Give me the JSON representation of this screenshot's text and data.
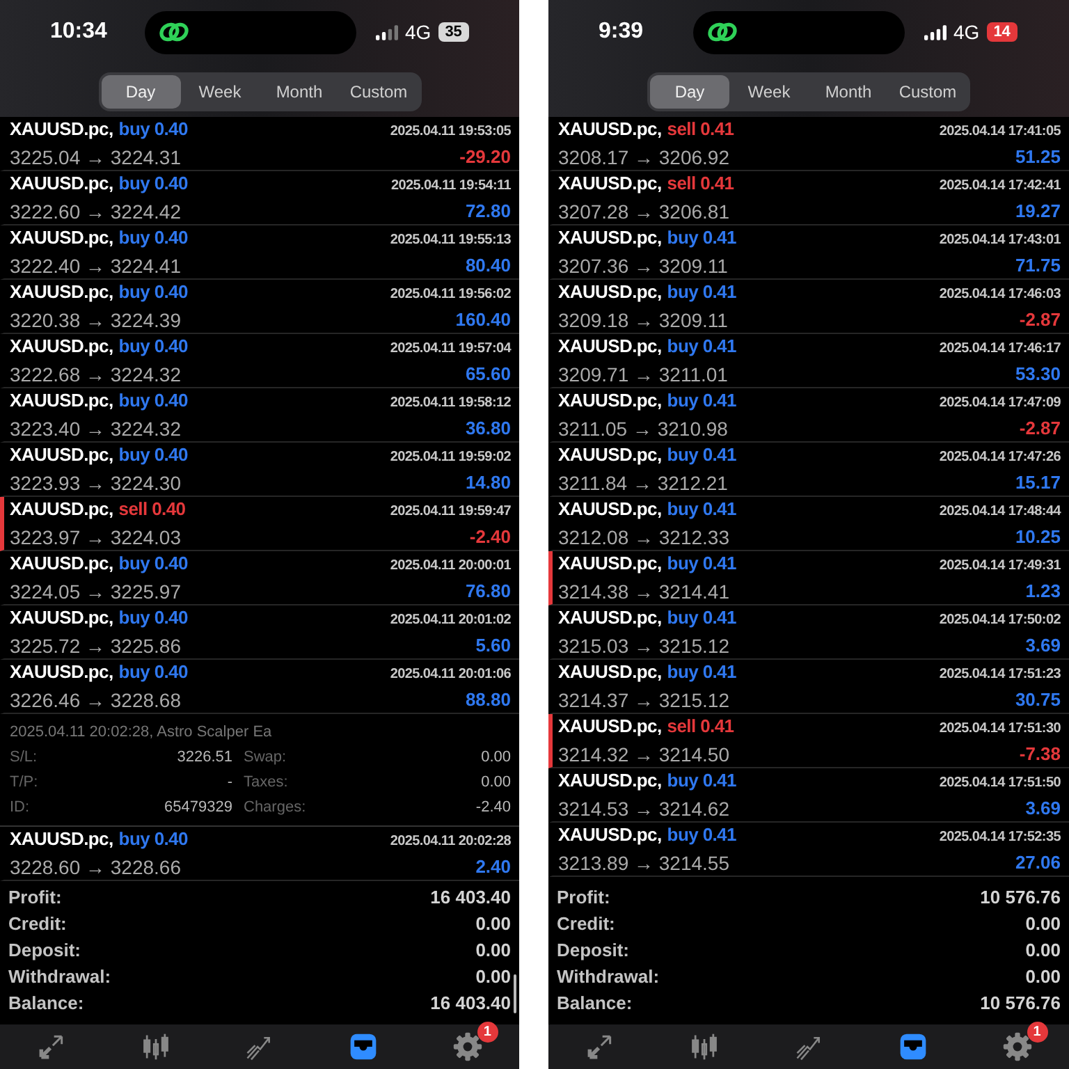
{
  "phones": [
    {
      "status": {
        "time": "10:34",
        "network": "4G",
        "battery": "35",
        "battery_low": false
      },
      "tabs": [
        {
          "label": "Day",
          "selected": true
        },
        {
          "label": "Week",
          "selected": false
        },
        {
          "label": "Month",
          "selected": false
        },
        {
          "label": "Custom",
          "selected": false
        }
      ],
      "items": [
        {
          "kind": "deal",
          "symbol": "XAUUSD.pc,",
          "side": "buy",
          "volume": "0.40",
          "time": "2025.04.11 19:53:05",
          "prices": "3225.04 → 3224.31",
          "profit": "-29.20",
          "negative": true,
          "marked": false
        },
        {
          "kind": "deal",
          "symbol": "XAUUSD.pc,",
          "side": "buy",
          "volume": "0.40",
          "time": "2025.04.11 19:54:11",
          "prices": "3222.60 → 3224.42",
          "profit": "72.80",
          "negative": false,
          "marked": false
        },
        {
          "kind": "deal",
          "symbol": "XAUUSD.pc,",
          "side": "buy",
          "volume": "0.40",
          "time": "2025.04.11 19:55:13",
          "prices": "3222.40 → 3224.41",
          "profit": "80.40",
          "negative": false,
          "marked": false
        },
        {
          "kind": "deal",
          "symbol": "XAUUSD.pc,",
          "side": "buy",
          "volume": "0.40",
          "time": "2025.04.11 19:56:02",
          "prices": "3220.38 → 3224.39",
          "profit": "160.40",
          "negative": false,
          "marked": false
        },
        {
          "kind": "deal",
          "symbol": "XAUUSD.pc,",
          "side": "buy",
          "volume": "0.40",
          "time": "2025.04.11 19:57:04",
          "prices": "3222.68 → 3224.32",
          "profit": "65.60",
          "negative": false,
          "marked": false
        },
        {
          "kind": "deal",
          "symbol": "XAUUSD.pc,",
          "side": "buy",
          "volume": "0.40",
          "time": "2025.04.11 19:58:12",
          "prices": "3223.40 → 3224.32",
          "profit": "36.80",
          "negative": false,
          "marked": false
        },
        {
          "kind": "deal",
          "symbol": "XAUUSD.pc,",
          "side": "buy",
          "volume": "0.40",
          "time": "2025.04.11 19:59:02",
          "prices": "3223.93 → 3224.30",
          "profit": "14.80",
          "negative": false,
          "marked": false
        },
        {
          "kind": "deal",
          "symbol": "XAUUSD.pc,",
          "side": "sell",
          "volume": "0.40",
          "time": "2025.04.11 19:59:47",
          "prices": "3223.97 → 3224.03",
          "profit": "-2.40",
          "negative": true,
          "marked": true
        },
        {
          "kind": "deal",
          "symbol": "XAUUSD.pc,",
          "side": "buy",
          "volume": "0.40",
          "time": "2025.04.11 20:00:01",
          "prices": "3224.05 → 3225.97",
          "profit": "76.80",
          "negative": false,
          "marked": false
        },
        {
          "kind": "deal",
          "symbol": "XAUUSD.pc,",
          "side": "buy",
          "volume": "0.40",
          "time": "2025.04.11 20:01:02",
          "prices": "3225.72 → 3225.86",
          "profit": "5.60",
          "negative": false,
          "marked": false
        },
        {
          "kind": "deal",
          "symbol": "XAUUSD.pc,",
          "side": "buy",
          "volume": "0.40",
          "time": "2025.04.11 20:01:06",
          "prices": "3226.46 → 3228.68",
          "profit": "88.80",
          "negative": false,
          "marked": false
        },
        {
          "kind": "detail",
          "comment": "2025.04.11 20:02:28, Astro Scalper Ea",
          "rows": [
            {
              "fields": [
                {
                  "label": "S/L:",
                  "value": "3226.51"
                },
                {
                  "label": "Swap:",
                  "value": "0.00"
                }
              ]
            },
            {
              "fields": [
                {
                  "label": "T/P:",
                  "value": "-"
                },
                {
                  "label": "Taxes:",
                  "value": "0.00"
                }
              ]
            },
            {
              "fields": [
                {
                  "label": "ID:",
                  "value": "65479329"
                },
                {
                  "label": "Charges:",
                  "value": "-2.40"
                }
              ]
            }
          ]
        },
        {
          "kind": "deal",
          "symbol": "XAUUSD.pc,",
          "side": "buy",
          "volume": "0.40",
          "time": "2025.04.11 20:02:28",
          "prices": "3228.60 → 3228.66",
          "profit": "2.40",
          "negative": false,
          "marked": false
        }
      ],
      "summary": [
        {
          "label": "Profit:",
          "value": "16 403.40"
        },
        {
          "label": "Credit:",
          "value": "0.00"
        },
        {
          "label": "Deposit:",
          "value": "0.00"
        },
        {
          "label": "Withdrawal:",
          "value": "0.00"
        },
        {
          "label": "Balance:",
          "value": "16 403.40"
        }
      ],
      "nav": [
        {
          "kind": "trade",
          "selected": false
        },
        {
          "kind": "chart",
          "selected": false
        },
        {
          "kind": "analytics",
          "selected": false
        },
        {
          "kind": "history",
          "selected": true
        },
        {
          "kind": "settings",
          "selected": false,
          "badge": "1"
        }
      ]
    },
    {
      "status": {
        "time": "9:39",
        "network": "4G",
        "battery": "14",
        "battery_low": true
      },
      "tabs": [
        {
          "label": "Day",
          "selected": true
        },
        {
          "label": "Week",
          "selected": false
        },
        {
          "label": "Month",
          "selected": false
        },
        {
          "label": "Custom",
          "selected": false
        }
      ],
      "items": [
        {
          "kind": "deal",
          "symbol": "XAUUSD.pc,",
          "side": "sell",
          "volume": "0.41",
          "time": "2025.04.14 17:41:05",
          "prices": "3208.17 → 3206.92",
          "profit": "51.25",
          "negative": false,
          "marked": false
        },
        {
          "kind": "deal",
          "symbol": "XAUUSD.pc,",
          "side": "sell",
          "volume": "0.41",
          "time": "2025.04.14 17:42:41",
          "prices": "3207.28 → 3206.81",
          "profit": "19.27",
          "negative": false,
          "marked": false
        },
        {
          "kind": "deal",
          "symbol": "XAUUSD.pc,",
          "side": "buy",
          "volume": "0.41",
          "time": "2025.04.14 17:43:01",
          "prices": "3207.36 → 3209.11",
          "profit": "71.75",
          "negative": false,
          "marked": false
        },
        {
          "kind": "deal",
          "symbol": "XAUUSD.pc,",
          "side": "buy",
          "volume": "0.41",
          "time": "2025.04.14 17:46:03",
          "prices": "3209.18 → 3209.11",
          "profit": "-2.87",
          "negative": true,
          "marked": false
        },
        {
          "kind": "deal",
          "symbol": "XAUUSD.pc,",
          "side": "buy",
          "volume": "0.41",
          "time": "2025.04.14 17:46:17",
          "prices": "3209.71 → 3211.01",
          "profit": "53.30",
          "negative": false,
          "marked": false
        },
        {
          "kind": "deal",
          "symbol": "XAUUSD.pc,",
          "side": "buy",
          "volume": "0.41",
          "time": "2025.04.14 17:47:09",
          "prices": "3211.05 → 3210.98",
          "profit": "-2.87",
          "negative": true,
          "marked": false
        },
        {
          "kind": "deal",
          "symbol": "XAUUSD.pc,",
          "side": "buy",
          "volume": "0.41",
          "time": "2025.04.14 17:47:26",
          "prices": "3211.84 → 3212.21",
          "profit": "15.17",
          "negative": false,
          "marked": false
        },
        {
          "kind": "deal",
          "symbol": "XAUUSD.pc,",
          "side": "buy",
          "volume": "0.41",
          "time": "2025.04.14 17:48:44",
          "prices": "3212.08 → 3212.33",
          "profit": "10.25",
          "negative": false,
          "marked": false
        },
        {
          "kind": "deal",
          "symbol": "XAUUSD.pc,",
          "side": "buy",
          "volume": "0.41",
          "time": "2025.04.14 17:49:31",
          "prices": "3214.38 → 3214.41",
          "profit": "1.23",
          "negative": false,
          "marked": true
        },
        {
          "kind": "deal",
          "symbol": "XAUUSD.pc,",
          "side": "buy",
          "volume": "0.41",
          "time": "2025.04.14 17:50:02",
          "prices": "3215.03 → 3215.12",
          "profit": "3.69",
          "negative": false,
          "marked": false
        },
        {
          "kind": "deal",
          "symbol": "XAUUSD.pc,",
          "side": "buy",
          "volume": "0.41",
          "time": "2025.04.14 17:51:23",
          "prices": "3214.37 → 3215.12",
          "profit": "30.75",
          "negative": false,
          "marked": false
        },
        {
          "kind": "deal",
          "symbol": "XAUUSD.pc,",
          "side": "sell",
          "volume": "0.41",
          "time": "2025.04.14 17:51:30",
          "prices": "3214.32 → 3214.50",
          "profit": "-7.38",
          "negative": true,
          "marked": true
        },
        {
          "kind": "deal",
          "symbol": "XAUUSD.pc,",
          "side": "buy",
          "volume": "0.41",
          "time": "2025.04.14 17:51:50",
          "prices": "3214.53 → 3214.62",
          "profit": "3.69",
          "negative": false,
          "marked": false
        },
        {
          "kind": "deal",
          "symbol": "XAUUSD.pc,",
          "side": "buy",
          "volume": "0.41",
          "time": "2025.04.14 17:52:35",
          "prices": "3213.89 → 3214.55",
          "profit": "27.06",
          "negative": false,
          "marked": false
        }
      ],
      "summary": [
        {
          "label": "Profit:",
          "value": "10 576.76"
        },
        {
          "label": "Credit:",
          "value": "0.00"
        },
        {
          "label": "Deposit:",
          "value": "0.00"
        },
        {
          "label": "Withdrawal:",
          "value": "0.00"
        },
        {
          "label": "Balance:",
          "value": "10 576.76"
        }
      ],
      "nav": [
        {
          "kind": "trade",
          "selected": false
        },
        {
          "kind": "chart",
          "selected": false
        },
        {
          "kind": "analytics",
          "selected": false
        },
        {
          "kind": "history",
          "selected": true
        },
        {
          "kind": "settings",
          "selected": false,
          "badge": "1"
        }
      ]
    }
  ]
}
